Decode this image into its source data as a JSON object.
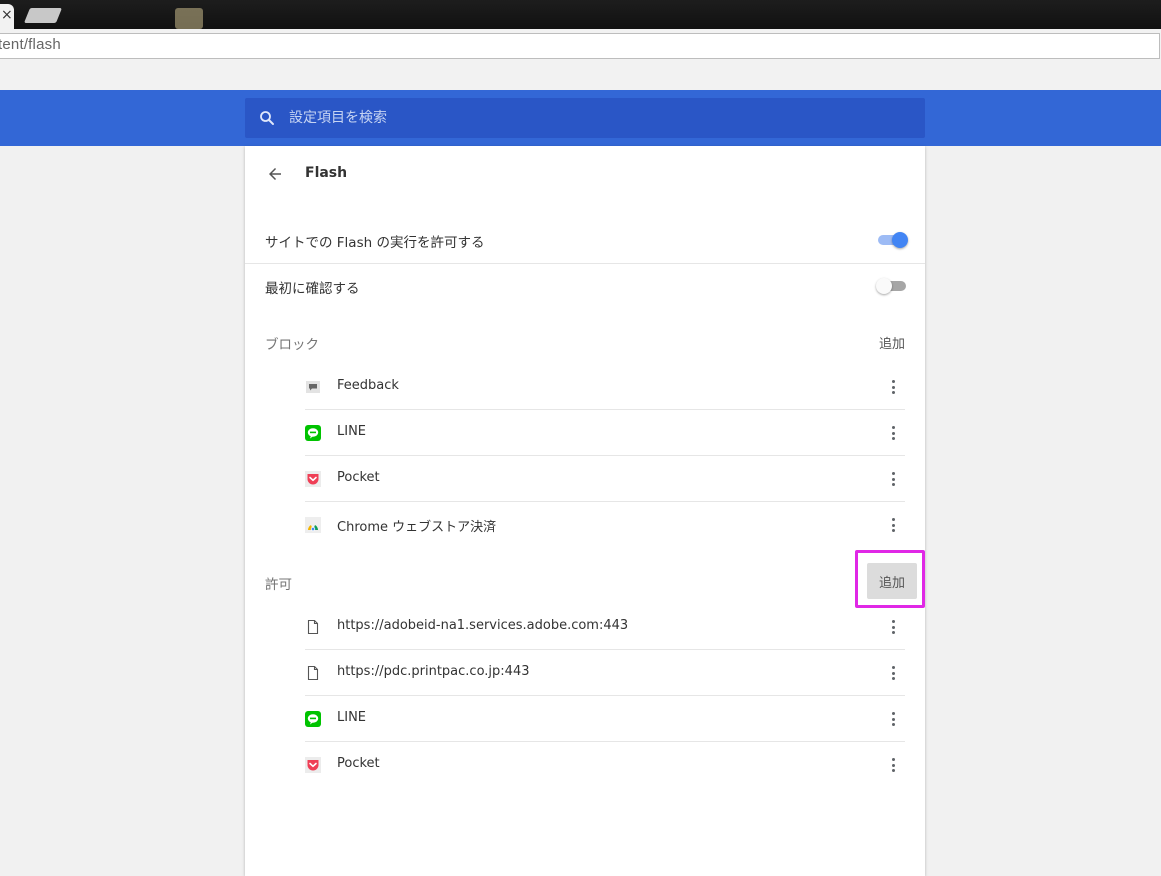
{
  "browser": {
    "tab_close_glyph": "×",
    "url": "tent/flash"
  },
  "search": {
    "placeholder": "設定項目を検索"
  },
  "page": {
    "title": "Flash"
  },
  "settings": {
    "allow_flash": {
      "label": "サイトでの Flash の実行を許可する",
      "enabled": true
    },
    "ask_first": {
      "label": "最初に確認する",
      "enabled": false
    }
  },
  "block": {
    "title": "ブロック",
    "add_label": "追加",
    "sites": [
      {
        "name": "Feedback",
        "icon": "feedback-icon"
      },
      {
        "name": "LINE",
        "icon": "line-icon"
      },
      {
        "name": "Pocket",
        "icon": "pocket-icon"
      },
      {
        "name": "Chrome ウェブストア決済",
        "icon": "chrome-icon"
      }
    ]
  },
  "allow": {
    "title": "許可",
    "add_label": "追加",
    "sites": [
      {
        "name": "https://adobeid-na1.services.adobe.com:443",
        "icon": "page-icon"
      },
      {
        "name": "https://pdc.printpac.co.jp:443",
        "icon": "page-icon"
      },
      {
        "name": "LINE",
        "icon": "line-icon"
      },
      {
        "name": "Pocket",
        "icon": "pocket-icon"
      }
    ]
  },
  "colors": {
    "header_blue": "#3367d6",
    "search_blue": "#2a56c6",
    "toggle_on": "#4285f4",
    "highlight": "#e028e6"
  }
}
